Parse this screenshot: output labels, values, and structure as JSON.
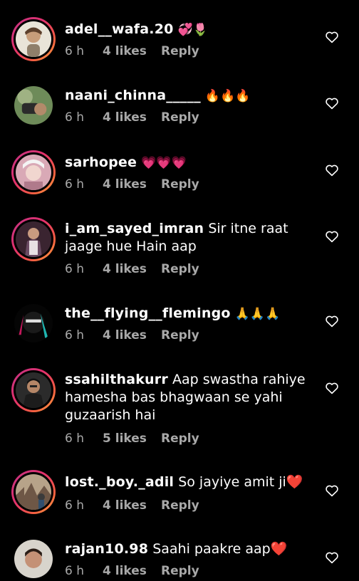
{
  "colors": {
    "background": "#000000",
    "meta": "#a8a8a8",
    "ring_start": "#c13584",
    "ring_end": "#fcaf45"
  },
  "comments": [
    {
      "username": "adel__wafa.20",
      "text": "💞🌷",
      "time": "6 h",
      "likes": "4 likes",
      "reply": "Reply",
      "ring": true
    },
    {
      "username": "naani_chinna_____",
      "text": "🔥🔥🔥",
      "time": "6 h",
      "likes": "4 likes",
      "reply": "Reply",
      "ring": false
    },
    {
      "username": "sarhopee",
      "text": "💗💗💗",
      "time": "6 h",
      "likes": "4 likes",
      "reply": "Reply",
      "ring": true
    },
    {
      "username": "i_am_sayed_imran",
      "text": "Sir itne raat jaage hue Hain aap",
      "time": "6 h",
      "likes": "4 likes",
      "reply": "Reply",
      "ring": true
    },
    {
      "username": "the__flying__flemingo",
      "text": "🙏🙏🙏",
      "time": "6 h",
      "likes": "4 likes",
      "reply": "Reply",
      "ring": false
    },
    {
      "username": "ssahilthakurr",
      "text": "Aap swastha rahiye hamesha bas bhagwaan se yahi guzaarish hai",
      "time": "6 h",
      "likes": "5 likes",
      "reply": "Reply",
      "ring": true
    },
    {
      "username": "lost._boy._adil",
      "text": "So jayiye amit ji❤️",
      "time": "6 h",
      "likes": "4 likes",
      "reply": "Reply",
      "ring": true
    },
    {
      "username": "rajan10.98",
      "text": "Saahi paakre aap❤️",
      "time": "6 h",
      "likes": "4 likes",
      "reply": "Reply",
      "ring": false
    }
  ],
  "icons": {
    "like": "heart-outline-icon"
  }
}
